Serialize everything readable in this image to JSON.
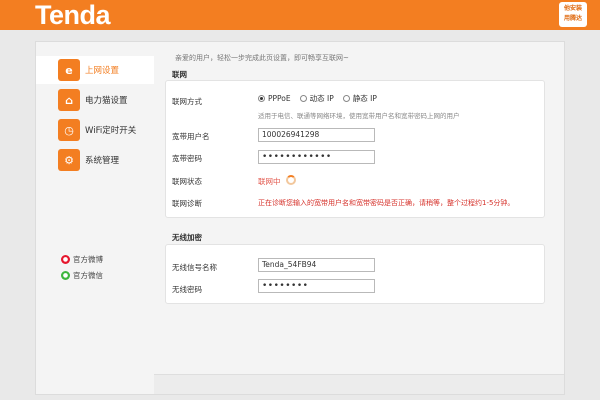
{
  "header": {
    "brand": "Tenda",
    "badge_line1": "他安装",
    "badge_line2": "用腾达",
    "color": "#f37e21"
  },
  "sidebar": {
    "items": [
      {
        "label": "上网设置",
        "icon": "globe-e-icon",
        "glyph": "e",
        "active": true
      },
      {
        "label": "电力猫设置",
        "icon": "house-plug-icon",
        "glyph": "⌂",
        "active": false
      },
      {
        "label": "WiFi定时开关",
        "icon": "clock-icon",
        "glyph": "◷",
        "active": false
      },
      {
        "label": "系统管理",
        "icon": "gear-icon",
        "glyph": "⚙",
        "active": false
      }
    ],
    "social": [
      {
        "label": "官方微博",
        "icon": "weibo-icon",
        "color": "#e6162d"
      },
      {
        "label": "官方微信",
        "icon": "wechat-icon",
        "color": "#3db53d"
      }
    ]
  },
  "main": {
    "intro": "亲爱的用户，轻松一步完成此页设置，即可畅享互联网~",
    "internet": {
      "title": "联网",
      "mode_label": "联网方式",
      "modes": [
        "PPPoE",
        "动态 IP",
        "静态 IP"
      ],
      "selected_mode": "PPPoE",
      "hint": "适用于电信、联通等网络环境，使用宽带用户名和宽带密码上网的用户",
      "username_label": "宽带用户名",
      "username_value": "100026941298",
      "password_label": "宽带密码",
      "password_value": "••••••••••••",
      "status_label": "联网状态",
      "status_value": "联网中",
      "diag_label": "联网诊断",
      "diag_value": "正在诊断您输入的宽带用户名和宽带密码是否正确，请稍等，整个过程约1-5分钟。"
    },
    "wireless": {
      "title": "无线加密",
      "ssid_label": "无线信号名称",
      "ssid_value": "Tenda_54FB94",
      "password_label": "无线密码",
      "password_value": "••••••••"
    }
  }
}
